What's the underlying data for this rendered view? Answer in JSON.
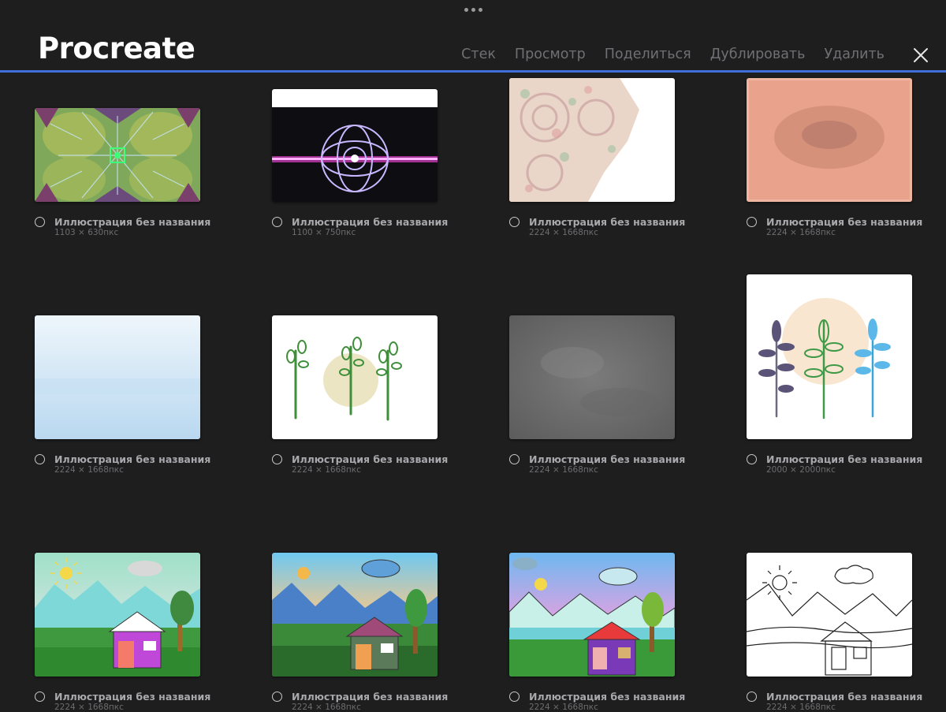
{
  "header": {
    "app_title": "Procreate",
    "actions": [
      "Стек",
      "Просмотр",
      "Поделиться",
      "Дублировать",
      "Удалить"
    ],
    "accent_color": "#3f6fd8"
  },
  "gallery": [
    {
      "name": "Иллюстрация без названия",
      "dims": "1103 × 630пкс",
      "preview": "kaleidoscope-green"
    },
    {
      "name": "Иллюстрация без названия",
      "dims": "1100 × 750пкс",
      "preview": "neon-rings"
    },
    {
      "name": "Иллюстрация без названия",
      "dims": "2224 × 1668пкс",
      "preview": "mandala-pastel"
    },
    {
      "name": "Иллюстрация без названия",
      "dims": "2224 × 1668пкс",
      "preview": "salmon-texture"
    },
    {
      "name": "Иллюстрация без названия",
      "dims": "2224 × 1668пкс",
      "preview": "light-blue-wash"
    },
    {
      "name": "Иллюстрация без названия",
      "dims": "2224 × 1668пкс",
      "preview": "three-green-sprouts"
    },
    {
      "name": "Иллюстрация без названия",
      "dims": "2224 × 1668пкс",
      "preview": "gray-texture"
    },
    {
      "name": "Иллюстрация без названия",
      "dims": "2000 × 2000пкс",
      "preview": "three-colored-plants"
    },
    {
      "name": "Иллюстрация без названия",
      "dims": "2224 × 1668пкс",
      "preview": "landscape-pink-house"
    },
    {
      "name": "Иллюстрация без названия",
      "dims": "2224 × 1668пкс",
      "preview": "landscape-sunset-house"
    },
    {
      "name": "Иллюстрация без названия",
      "dims": "2224 × 1668пкс",
      "preview": "landscape-red-roof-house"
    },
    {
      "name": "Иллюстрация без названия",
      "dims": "2224 × 1668пкс",
      "preview": "landscape-line-sketch"
    }
  ]
}
